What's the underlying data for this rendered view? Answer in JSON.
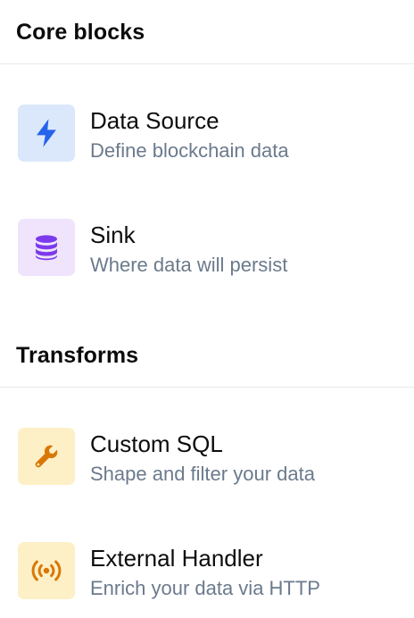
{
  "sections": [
    {
      "title": "Core blocks",
      "items": [
        {
          "title": "Data Source",
          "subtitle": "Define blockchain data",
          "icon": "lightning-bolt-icon",
          "color": "#2563eb",
          "tile": "#dbe8fb"
        },
        {
          "title": "Sink",
          "subtitle": "Where data will persist",
          "icon": "database-icon",
          "color": "#7c3aed",
          "tile": "#efe4fc"
        }
      ]
    },
    {
      "title": "Transforms",
      "items": [
        {
          "title": "Custom SQL",
          "subtitle": "Shape and filter your data",
          "icon": "wrench-icon",
          "color": "#d97706",
          "tile": "#fdf0c6"
        },
        {
          "title": "External Handler",
          "subtitle": "Enrich your data via HTTP",
          "icon": "broadcast-icon",
          "color": "#d97706",
          "tile": "#fdf0c6"
        }
      ]
    }
  ]
}
